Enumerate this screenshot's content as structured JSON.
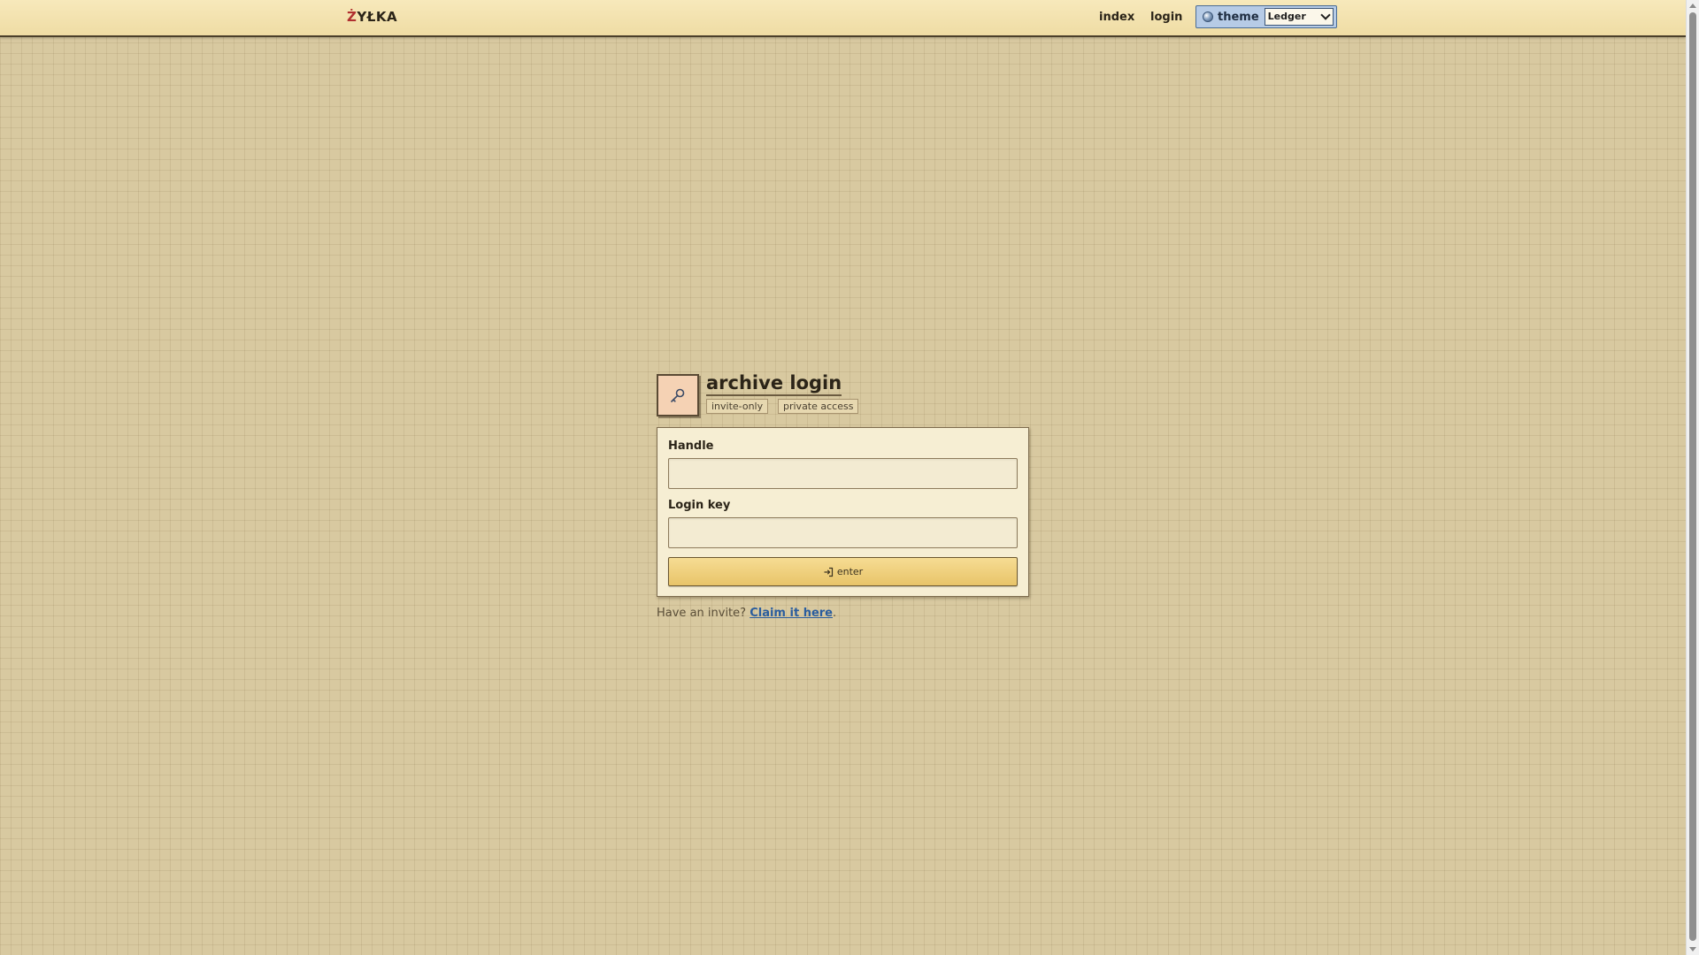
{
  "header": {
    "brand_first": "Ż",
    "brand_rest": "YŁKA",
    "nav": {
      "index": "index",
      "login": "login"
    },
    "theme": {
      "label": "theme",
      "selected": "Ledger"
    }
  },
  "login": {
    "title": "archive login",
    "chips": [
      "invite-only",
      "private access"
    ],
    "form": {
      "handle_label": "Handle",
      "handle_value": "",
      "key_label": "Login key",
      "key_value": "",
      "submit_label": "enter"
    },
    "invite": {
      "prompt": "Have an invite?",
      "link": "Claim it here",
      "suffix": "."
    }
  },
  "icons": {
    "tile": "key-icon",
    "theme": "globe-icon",
    "submit": "sign-in-icon"
  },
  "colors": {
    "page_background": "#d8c9a0",
    "header_background": "#f7e9bb",
    "theme_box": "#b6cbe6",
    "key_tile": "#f5d2b4",
    "card": "#f6eed3",
    "button": "#e8c469",
    "link": "#2a5d9e",
    "brand_accent": "#b03030"
  }
}
